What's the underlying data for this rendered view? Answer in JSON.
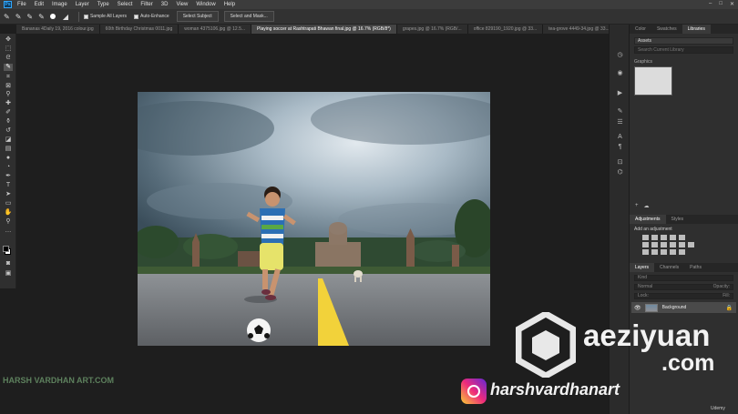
{
  "app": {
    "logo": "Ps"
  },
  "menu": [
    "File",
    "Edit",
    "Image",
    "Layer",
    "Type",
    "Select",
    "Filter",
    "3D",
    "View",
    "Window",
    "Help"
  ],
  "options": {
    "sample_all_layers": "Sample All Layers",
    "auto_enhance": "Auto-Enhance",
    "select_subject": "Select Subject",
    "select_and_mask": "Select and Mask..."
  },
  "tabs": [
    "Bananas 4Daily 19, 2016 colour.jpg",
    "60th Birthday Christmas 0011.jpg",
    "woman 4375106.jpg @ 12.5...",
    "Playing soccer at Rashtrapati Bhawan final.jpg @ 16.7% (RGB/8*)",
    "grapes.jpg @ 16.7% (RGB/...",
    "office 829190_1920.jpg @ 33...",
    "tea-grove 4449-34.jpg @ 33..."
  ],
  "active_tab_index": 3,
  "panels": {
    "top_tabs": [
      "Color",
      "Swatches",
      "Libraries"
    ],
    "active_top_tab": 2,
    "library_select": "Assets",
    "library_search_placeholder": "Search Current Library",
    "library_group": "Graphics",
    "adjust_tabs": [
      "Adjustments",
      "Styles"
    ],
    "add_adjustment": "Add an adjustment",
    "layer_tabs": [
      "Layers",
      "Channels",
      "Paths"
    ],
    "kind_label": "Kind",
    "mode_label": "Normal",
    "opacity_label": "Opacity:",
    "lock_label": "Lock:",
    "fill_label": "Fill:",
    "layer_name": "Background"
  },
  "watermarks": {
    "brand_line1": "aeziyuan",
    "brand_line2": ".com",
    "handle": "harshvardhanart",
    "artist": "HARSH VARDHAN ART.COM",
    "corner": "Udemy"
  },
  "colors": {
    "accent_blue": "#31a8ff",
    "instagram": "#c13584"
  }
}
